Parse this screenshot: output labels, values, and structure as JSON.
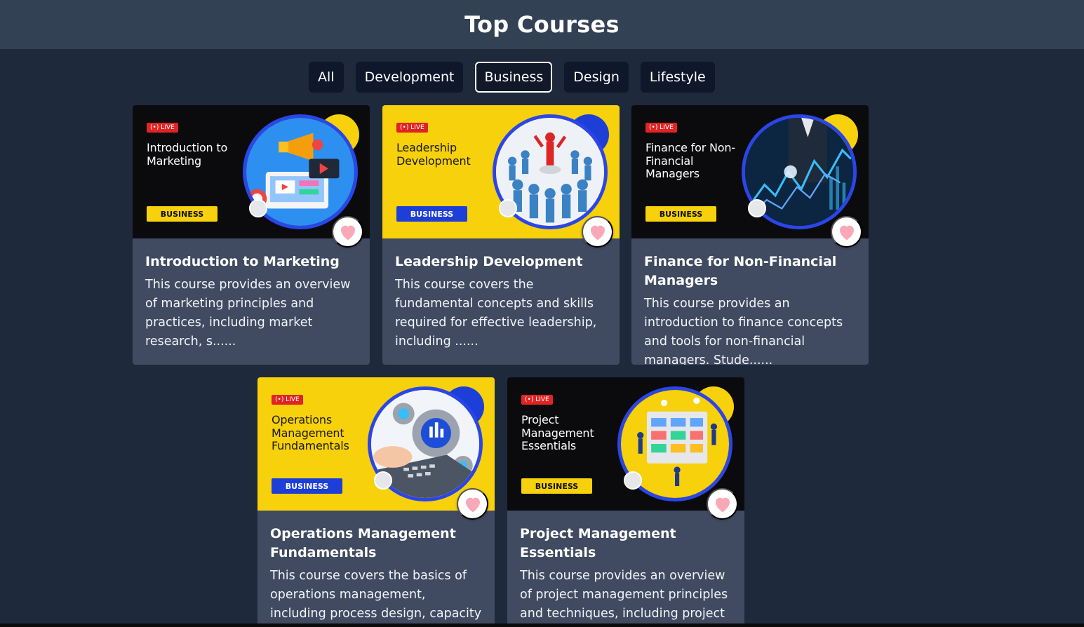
{
  "header": {
    "title": "Top Courses"
  },
  "filters": [
    {
      "label": "All",
      "active": false
    },
    {
      "label": "Development",
      "active": false
    },
    {
      "label": "Business",
      "active": true
    },
    {
      "label": "Design",
      "active": false
    },
    {
      "label": "Lifestyle",
      "active": false
    }
  ],
  "courses": [
    {
      "thumb_live": "(•) LIVE",
      "thumb_title": "Introduction to Marketing",
      "thumb_category": "BUSINESS",
      "thumb_theme": "black",
      "title": "Introduction to Marketing",
      "description": "This course provides an overview of marketing principles and practices, including market research, s......",
      "icon": "heart-icon"
    },
    {
      "thumb_live": "(•) LIVE",
      "thumb_title": "Leadership Development",
      "thumb_category": "BUSINESS",
      "thumb_theme": "yellow",
      "title": "Leadership Development",
      "description": "This course covers the fundamental concepts and skills required for effective leadership, including ......",
      "icon": "heart-icon"
    },
    {
      "thumb_live": "(•) LIVE",
      "thumb_title": "Finance for Non-Financial Managers",
      "thumb_category": "BUSINESS",
      "thumb_theme": "black",
      "title": "Finance for Non-Financial Managers",
      "description": "This course provides an introduction to finance concepts and tools for non-financial managers. Stude......",
      "icon": "heart-icon"
    },
    {
      "thumb_live": "(•) LIVE",
      "thumb_title": "Operations Management Fundamentals",
      "thumb_category": "BUSINESS",
      "thumb_theme": "yellow",
      "title": "Operations Management Fundamentals",
      "description": "This course covers the basics of operations management, including process design, capacity planning,......",
      "icon": "heart-icon"
    },
    {
      "thumb_live": "(•) LIVE",
      "thumb_title": "Project Management Essentials",
      "thumb_category": "BUSINESS",
      "thumb_theme": "black",
      "title": "Project Management Essentials",
      "description": "This course provides an overview of project management principles and techniques, including project ......",
      "icon": "heart-icon"
    }
  ],
  "colors": {
    "page_bg": "#1e293b",
    "header_bg": "#334155",
    "card_bg": "#404b61",
    "brand_yellow": "#f7d10b",
    "brand_blue": "#1d3fd8",
    "live_red": "#e02424",
    "heart_pink": "#f9a8b8"
  }
}
